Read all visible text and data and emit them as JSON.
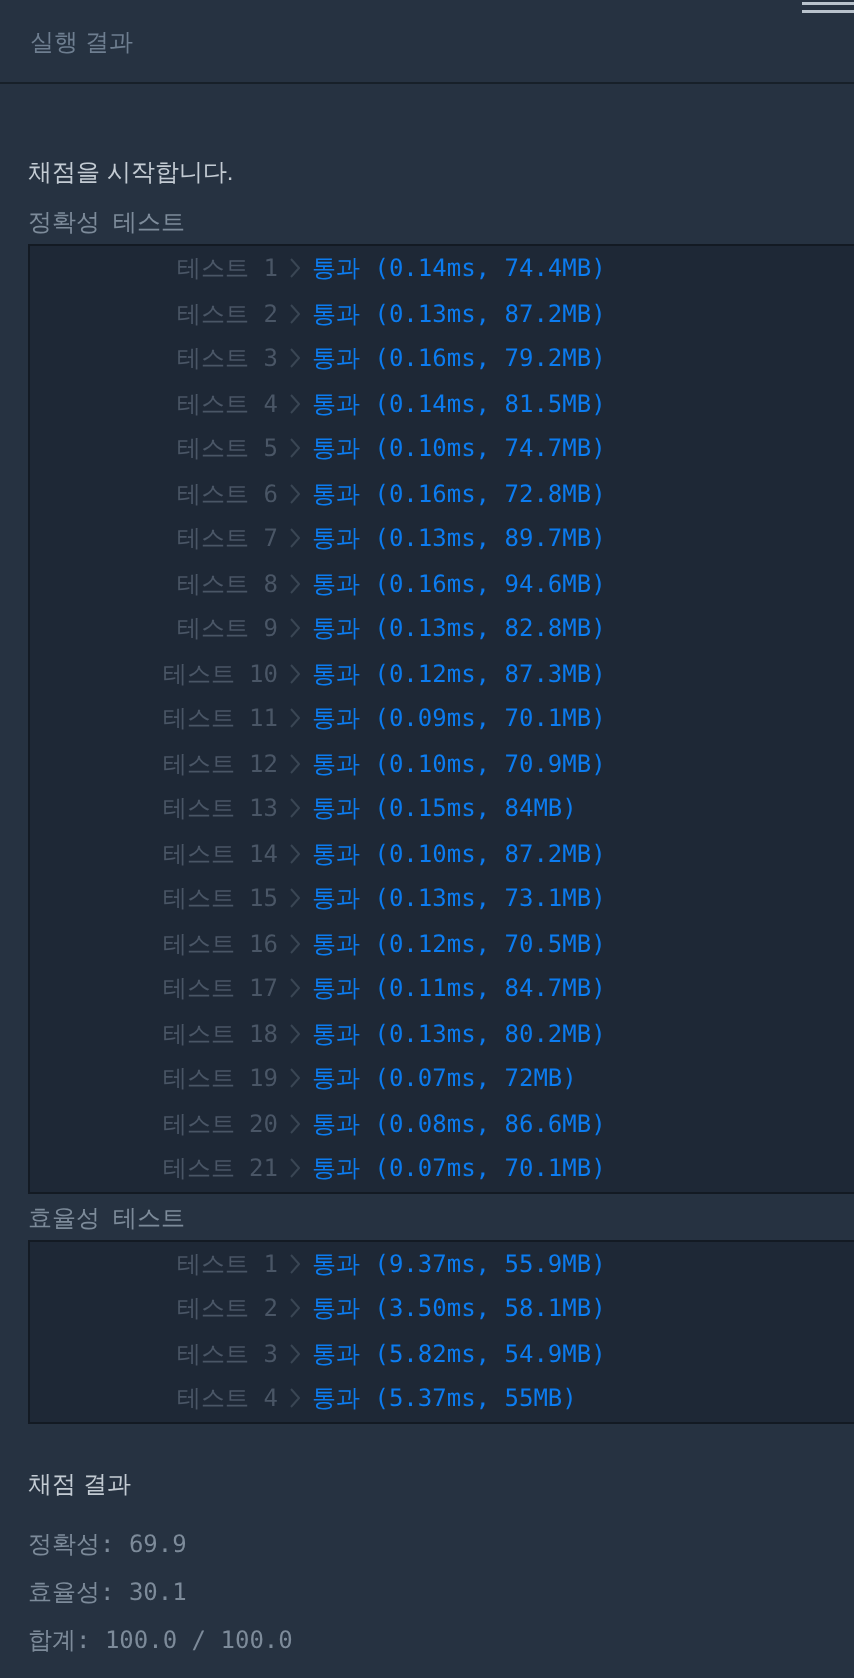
{
  "header": {
    "title": "실행 결과"
  },
  "status": "채점을 시작합니다.",
  "sections": [
    {
      "title": "정확성  테스트",
      "tests": [
        {
          "label": "테스트 1",
          "result": "통과 (0.14ms, 74.4MB)"
        },
        {
          "label": "테스트 2",
          "result": "통과 (0.13ms, 87.2MB)"
        },
        {
          "label": "테스트 3",
          "result": "통과 (0.16ms, 79.2MB)"
        },
        {
          "label": "테스트 4",
          "result": "통과 (0.14ms, 81.5MB)"
        },
        {
          "label": "테스트 5",
          "result": "통과 (0.10ms, 74.7MB)"
        },
        {
          "label": "테스트 6",
          "result": "통과 (0.16ms, 72.8MB)"
        },
        {
          "label": "테스트 7",
          "result": "통과 (0.13ms, 89.7MB)"
        },
        {
          "label": "테스트 8",
          "result": "통과 (0.16ms, 94.6MB)"
        },
        {
          "label": "테스트 9",
          "result": "통과 (0.13ms, 82.8MB)"
        },
        {
          "label": "테스트 10",
          "result": "통과 (0.12ms, 87.3MB)"
        },
        {
          "label": "테스트 11",
          "result": "통과 (0.09ms, 70.1MB)"
        },
        {
          "label": "테스트 12",
          "result": "통과 (0.10ms, 70.9MB)"
        },
        {
          "label": "테스트 13",
          "result": "통과 (0.15ms, 84MB)"
        },
        {
          "label": "테스트 14",
          "result": "통과 (0.10ms, 87.2MB)"
        },
        {
          "label": "테스트 15",
          "result": "통과 (0.13ms, 73.1MB)"
        },
        {
          "label": "테스트 16",
          "result": "통과 (0.12ms, 70.5MB)"
        },
        {
          "label": "테스트 17",
          "result": "통과 (0.11ms, 84.7MB)"
        },
        {
          "label": "테스트 18",
          "result": "통과 (0.13ms, 80.2MB)"
        },
        {
          "label": "테스트 19",
          "result": "통과 (0.07ms, 72MB)"
        },
        {
          "label": "테스트 20",
          "result": "통과 (0.08ms, 86.6MB)"
        },
        {
          "label": "테스트 21",
          "result": "통과 (0.07ms, 70.1MB)"
        }
      ]
    },
    {
      "title": "효율성  테스트",
      "tests": [
        {
          "label": "테스트 1",
          "result": "통과 (9.37ms, 55.9MB)"
        },
        {
          "label": "테스트 2",
          "result": "통과 (3.50ms, 58.1MB)"
        },
        {
          "label": "테스트 3",
          "result": "통과 (5.82ms, 54.9MB)"
        },
        {
          "label": "테스트 4",
          "result": "통과 (5.37ms, 55MB)"
        }
      ]
    }
  ],
  "summary": {
    "title": "채점 결과",
    "lines": [
      "정확성: 69.9",
      "효율성: 30.1",
      "합계: 100.0 / 100.0"
    ]
  }
}
